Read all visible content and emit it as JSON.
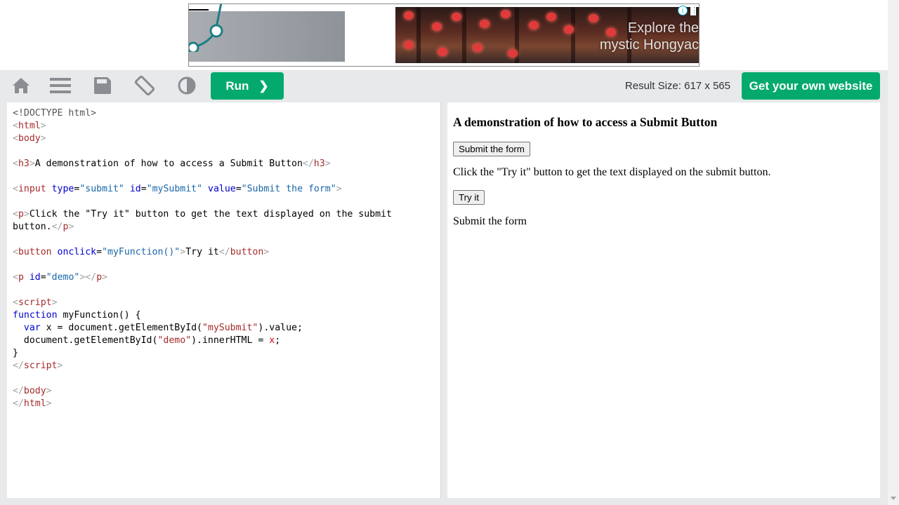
{
  "ad": {
    "headline": "Explore the",
    "subline": "mystic Hongyac",
    "info_icon": "i",
    "menu_icon": "⋮"
  },
  "toolbar": {
    "icons": [
      "home-icon",
      "menu-icon",
      "save-icon",
      "rotate-icon",
      "contrast-icon"
    ],
    "run_label": "Run",
    "run_chevron": "❯",
    "result_size": "Result Size: 617 x 565",
    "own_site_label": "Get your own website"
  },
  "colors": {
    "accent": "#04aa6d",
    "toolbar_bg": "#e7e9eb"
  },
  "code": {
    "lines": [
      [
        [
          "dt",
          "<!DOCTYPE html>"
        ]
      ],
      [
        [
          "br",
          "<"
        ],
        [
          "tag",
          "html"
        ],
        [
          "br",
          ">"
        ]
      ],
      [
        [
          "br",
          "<"
        ],
        [
          "tag",
          "body"
        ],
        [
          "br",
          ">"
        ]
      ],
      [],
      [
        [
          "br",
          "<"
        ],
        [
          "tag",
          "h3"
        ],
        [
          "br",
          ">"
        ],
        [
          "txt",
          "A demonstration of how to access a Submit Button"
        ],
        [
          "br",
          "</"
        ],
        [
          "tag",
          "h3"
        ],
        [
          "br",
          ">"
        ]
      ],
      [],
      [
        [
          "br",
          "<"
        ],
        [
          "tag",
          "input"
        ],
        [
          "txt",
          " "
        ],
        [
          "attr",
          "type"
        ],
        [
          "txt",
          "="
        ],
        [
          "val",
          "\"submit\""
        ],
        [
          "txt",
          " "
        ],
        [
          "attr",
          "id"
        ],
        [
          "txt",
          "="
        ],
        [
          "val",
          "\"mySubmit\""
        ],
        [
          "txt",
          " "
        ],
        [
          "attr",
          "value"
        ],
        [
          "txt",
          "="
        ],
        [
          "val",
          "\"Submit the form\""
        ],
        [
          "br",
          ">"
        ]
      ],
      [],
      [
        [
          "br",
          "<"
        ],
        [
          "tag",
          "p"
        ],
        [
          "br",
          ">"
        ],
        [
          "txt",
          "Click the \"Try it\" button to get the text displayed on the submit"
        ]
      ],
      [
        [
          "txt",
          "button."
        ],
        [
          "br",
          "</"
        ],
        [
          "tag",
          "p"
        ],
        [
          "br",
          ">"
        ]
      ],
      [],
      [
        [
          "br",
          "<"
        ],
        [
          "tag",
          "button"
        ],
        [
          "txt",
          " "
        ],
        [
          "attr",
          "onclick"
        ],
        [
          "txt",
          "="
        ],
        [
          "val",
          "\"myFunction()\""
        ],
        [
          "br",
          ">"
        ],
        [
          "txt",
          "Try it"
        ],
        [
          "br",
          "</"
        ],
        [
          "tag",
          "button"
        ],
        [
          "br",
          ">"
        ]
      ],
      [],
      [
        [
          "br",
          "<"
        ],
        [
          "tag",
          "p"
        ],
        [
          "txt",
          " "
        ],
        [
          "attr",
          "id"
        ],
        [
          "txt",
          "="
        ],
        [
          "val",
          "\"demo\""
        ],
        [
          "br",
          ">"
        ],
        [
          "br",
          "</"
        ],
        [
          "tag",
          "p"
        ],
        [
          "br",
          ">"
        ]
      ],
      [],
      [
        [
          "br",
          "<"
        ],
        [
          "tag",
          "script"
        ],
        [
          "br",
          ">"
        ]
      ],
      [
        [
          "kw",
          "function"
        ],
        [
          "txt",
          " myFunction() {"
        ]
      ],
      [
        [
          "txt",
          "  "
        ],
        [
          "kw",
          "var"
        ],
        [
          "txt",
          " x = document.getElementById("
        ],
        [
          "str",
          "\"mySubmit\""
        ],
        [
          "txt",
          ").value;"
        ]
      ],
      [
        [
          "txt",
          "  document.getElementById("
        ],
        [
          "str",
          "\"demo\""
        ],
        [
          "txt",
          ").innerHTML = "
        ],
        [
          "red",
          "x"
        ],
        [
          "txt",
          ";"
        ]
      ],
      [
        [
          "txt",
          "}"
        ]
      ],
      [
        [
          "br",
          "</"
        ],
        [
          "tag",
          "script"
        ],
        [
          "br",
          ">"
        ]
      ],
      [],
      [
        [
          "br",
          "</"
        ],
        [
          "tag",
          "body"
        ],
        [
          "br",
          ">"
        ]
      ],
      [
        [
          "br",
          "</"
        ],
        [
          "tag",
          "html"
        ],
        [
          "br",
          ">"
        ]
      ]
    ]
  },
  "result": {
    "heading": "A demonstration of how to access a Submit Button",
    "submit_value": "Submit the form",
    "paragraph": "Click the \"Try it\" button to get the text displayed on the submit button.",
    "try_label": "Try it",
    "demo_output": "Submit the form"
  }
}
